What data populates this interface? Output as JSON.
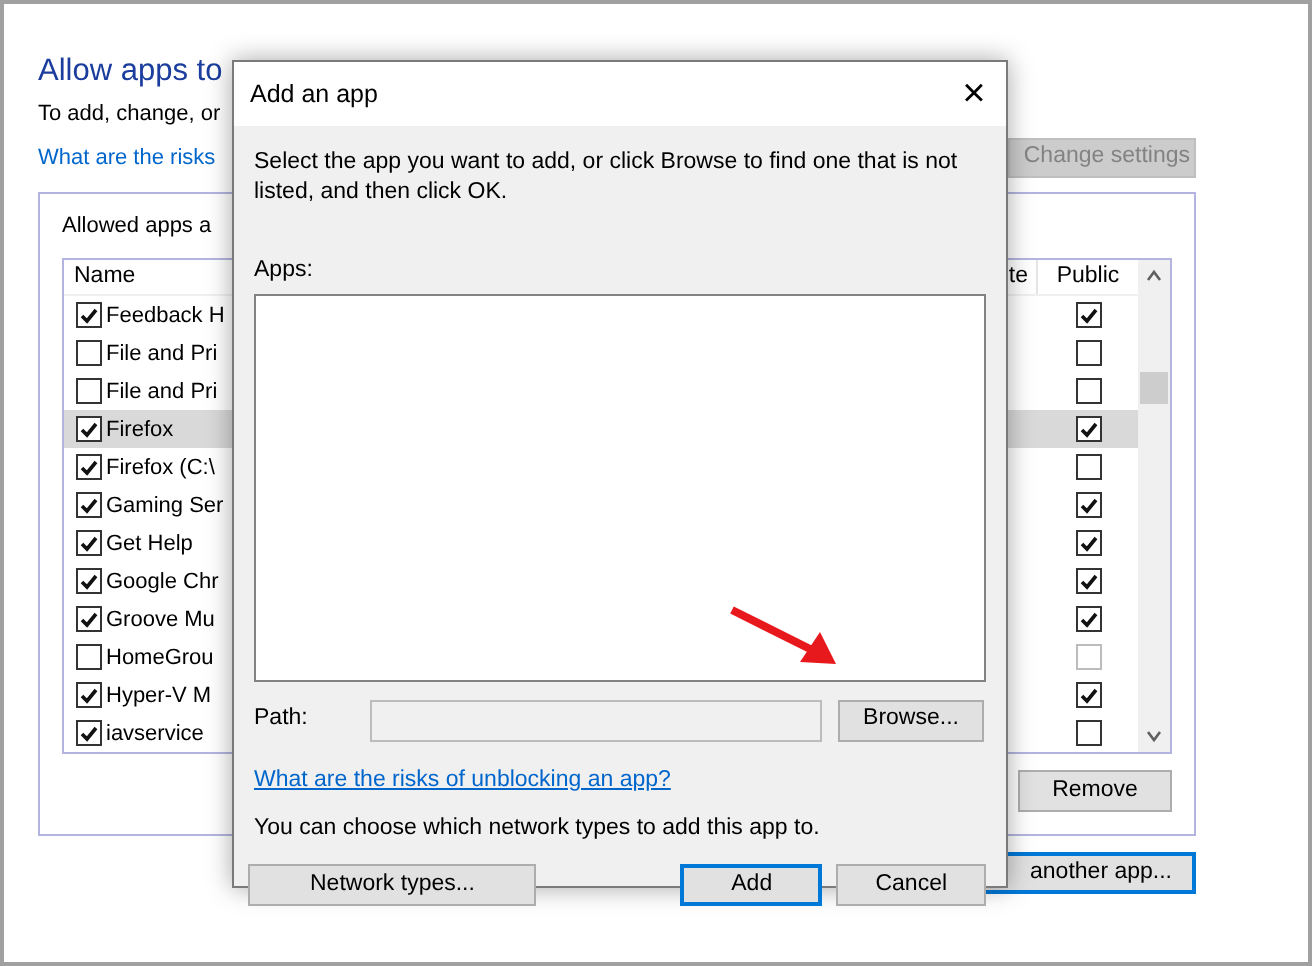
{
  "background_window": {
    "title": "Allow apps to",
    "instruction": "To add, change, or",
    "risks_link": "What are the risks",
    "change_settings_button": {
      "label": "Change settings",
      "disabled": true
    },
    "group_label": "Allowed apps a",
    "table": {
      "columns": [
        {
          "label": "Name"
        },
        {
          "label": "te"
        },
        {
          "label": "Public"
        }
      ],
      "rows": [
        {
          "name": "Feedback H",
          "checked": true,
          "public": true,
          "public_disabled": false,
          "selected": false
        },
        {
          "name": "File and Pri",
          "checked": false,
          "public": false,
          "public_disabled": false,
          "selected": false
        },
        {
          "name": "File and Pri",
          "checked": false,
          "public": false,
          "public_disabled": false,
          "selected": false
        },
        {
          "name": "Firefox",
          "checked": true,
          "public": true,
          "public_disabled": false,
          "selected": true
        },
        {
          "name": "Firefox (C:\\",
          "checked": true,
          "public": false,
          "public_disabled": false,
          "selected": false
        },
        {
          "name": "Gaming Ser",
          "checked": true,
          "public": true,
          "public_disabled": false,
          "selected": false
        },
        {
          "name": "Get Help",
          "checked": true,
          "public": true,
          "public_disabled": false,
          "selected": false
        },
        {
          "name": "Google Chr",
          "checked": true,
          "public": true,
          "public_disabled": false,
          "selected": false
        },
        {
          "name": "Groove Mu",
          "checked": true,
          "public": true,
          "public_disabled": false,
          "selected": false
        },
        {
          "name": "HomeGrou",
          "checked": false,
          "public": false,
          "public_disabled": true,
          "selected": false
        },
        {
          "name": "Hyper-V M",
          "checked": true,
          "public": true,
          "public_disabled": false,
          "selected": false
        },
        {
          "name": "iavservice",
          "checked": true,
          "public": false,
          "public_disabled": false,
          "selected": false
        }
      ]
    },
    "remove_button": "Remove",
    "another_app_button": "another app..."
  },
  "dialog": {
    "title": "Add an app",
    "close": "×",
    "description": "Select the app you want to add, or click Browse to find one that is not listed, and then click OK.",
    "apps_label": "Apps:",
    "path_label": "Path:",
    "browse_button": "Browse...",
    "risks_link": "What are the risks of unblocking an app?",
    "network_note": "You can choose which network types to add this app to.",
    "network_types_button": "Network types...",
    "add_button": "Add",
    "cancel_button": "Cancel"
  }
}
